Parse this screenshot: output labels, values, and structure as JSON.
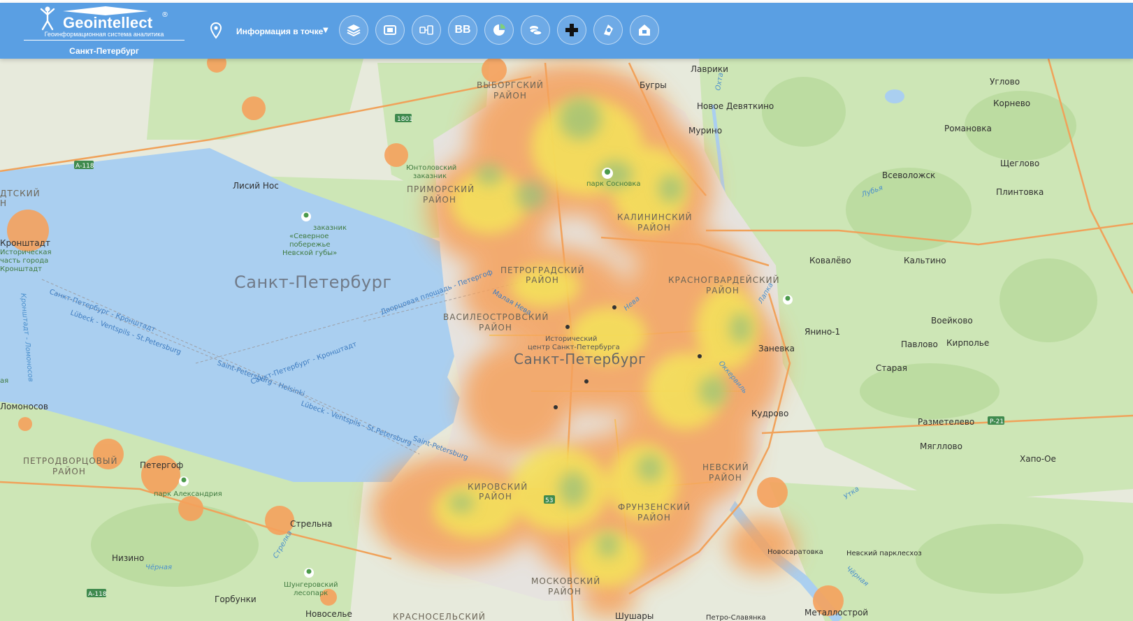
{
  "header": {
    "logo_name": "Geointellect",
    "logo_reg": "®",
    "logo_subtitle": "Геоинформационная система аналитика",
    "city": "Санкт-Петербург",
    "info_select_label": "Информация в точке",
    "tools": [
      {
        "icon": "layers-icon"
      },
      {
        "icon": "card-icon"
      },
      {
        "icon": "exchange-icon"
      },
      {
        "icon": "bb-icon",
        "text": "BB"
      },
      {
        "icon": "chart-icon"
      },
      {
        "icon": "coins-icon"
      },
      {
        "icon": "pharmacy-cross-icon"
      },
      {
        "icon": "lens-icon"
      },
      {
        "icon": "house-icon"
      }
    ]
  },
  "map": {
    "big_labels": [
      "Санкт-Петербург",
      "Санкт-Петербург"
    ],
    "districts": [
      [
        "ВЫБОРГСКИЙ",
        "РАЙОН"
      ],
      [
        "ПРИМОРСКИЙ",
        "РАЙОН"
      ],
      [
        "КАЛИНИНСКИЙ",
        "РАЙОН"
      ],
      [
        "ПЕТРОГРАДСКИЙ",
        "РАЙОН"
      ],
      [
        "КРАСНОГВАРДЕЙСКИЙ",
        "РАЙОН"
      ],
      [
        "ВАСИЛЕОСТРОВСКИЙ",
        "РАЙОН"
      ],
      [
        "НЕВСКИЙ",
        "РАЙОН"
      ],
      [
        "КИРОВСКИЙ",
        "РАЙОН"
      ],
      [
        "ФРУНЗЕНСКИЙ",
        "РАЙОН"
      ],
      [
        "МОСКОВСКИЙ",
        "РАЙОН"
      ],
      [
        "ПЕТРОДВОРЦОВЫЙ",
        "РАЙОН"
      ],
      [
        "КРАСНОСЕЛЬСКИЙ"
      ],
      [
        "ДТСКИЙ",
        "Н"
      ]
    ],
    "places": [
      "Лаврики",
      "Бугры",
      "Новое Девяткино",
      "Мурино",
      "Углово",
      "Корнево",
      "Романовка",
      "Всеволожск",
      "Щеглово",
      "Плинтовка",
      "Лисий Нос",
      "Кронштадт",
      "Ковалёво",
      "Кальтино",
      "Янино-1",
      "Воейково",
      "Заневка",
      "Павлово",
      "Кирполье",
      "Старая",
      "Кудрово",
      "Разметелево",
      "Мягллово",
      "Хапо-Ое",
      "Ломоносов",
      "Петергоф",
      "Стрельна",
      "Низино",
      "Горбунки",
      "Новоселье",
      "Шушары",
      "Петро-Славянка",
      "Металлострой",
      "Новосаратовка",
      "Невский парклесхоз"
    ],
    "parks": [
      [
        "Юнтоловский",
        "заказник"
      ],
      [
        "парк Сосновка"
      ],
      [
        "заказник",
        "«Северное",
        "побережье",
        "Невской губы»"
      ],
      [
        "Исторический",
        "центр Санкт-Петербурга"
      ],
      [
        "парк Александрия"
      ],
      [
        "Шунгеровский",
        "лесопарк"
      ],
      [
        "Историческая",
        "часть города",
        "Кронштадт"
      ],
      [
        "ая"
      ]
    ],
    "routes": [
      "Санкт-Петербург - Кронштадт",
      "Lübeck - Ventspils - St.Petersburg",
      "Saint-Petersburg - Helsinki",
      "Lübeck - Ventspils - St.Petersburg",
      "Saint-Petersburg",
      "Санкт-Петербург - Кронштадт",
      "Дворцовая площадь - Петергоф",
      "Малая Нева"
    ],
    "water": [
      "Нева",
      "Охта",
      "Оккервиль",
      "Лапка",
      "Чёрная",
      "Стрелка",
      "Утка",
      "Лубья",
      "Чёрная",
      "Кронштадт - Ломоносов"
    ],
    "shields": [
      "1801",
      "А-118",
      "А-118",
      "53",
      "Р-21"
    ]
  }
}
